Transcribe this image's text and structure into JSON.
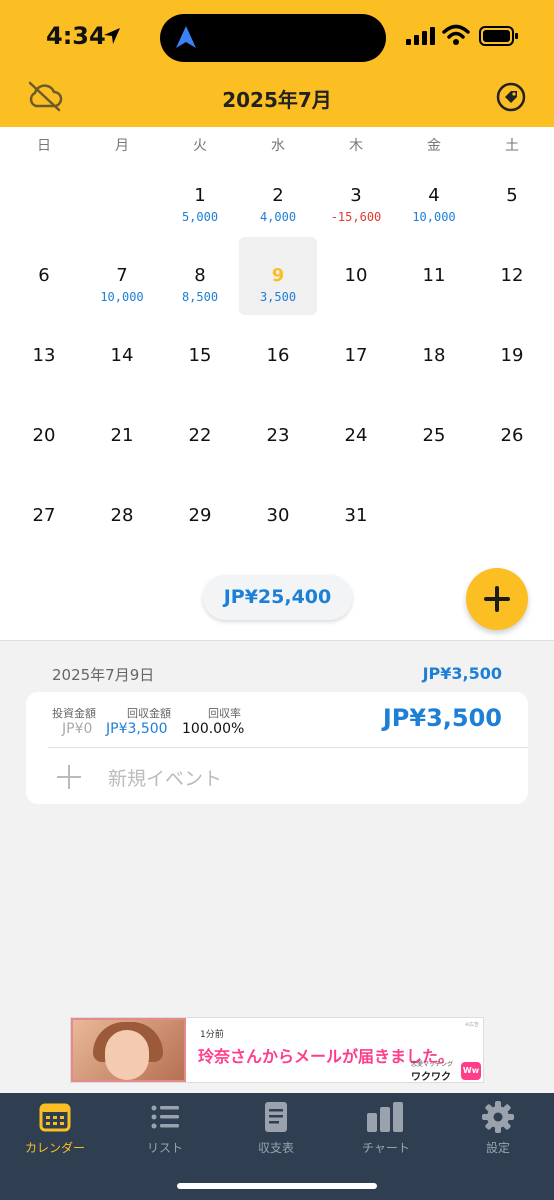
{
  "status_bar": {
    "time": "4:34"
  },
  "header": {
    "title": "2025年7月",
    "left_icon": "cloud-off-icon",
    "right_icon": "tag-icon"
  },
  "colors": {
    "accent": "#fbbf24",
    "positive": "#1d7fd6",
    "negative": "#e53935",
    "tabbar": "#2f3e50"
  },
  "calendar": {
    "weekdays": [
      "日",
      "月",
      "火",
      "水",
      "木",
      "金",
      "土"
    ],
    "selected_day": "9",
    "days": [
      {
        "day": "1",
        "amount": "5,000"
      },
      {
        "day": "2",
        "amount": "4,000"
      },
      {
        "day": "3",
        "amount": "-15,600"
      },
      {
        "day": "4",
        "amount": "10,000"
      },
      {
        "day": "5",
        "amount": ""
      },
      {
        "day": "6",
        "amount": ""
      },
      {
        "day": "7",
        "amount": "10,000"
      },
      {
        "day": "8",
        "amount": "8,500"
      },
      {
        "day": "9",
        "amount": "3,500"
      },
      {
        "day": "10",
        "amount": ""
      },
      {
        "day": "11",
        "amount": ""
      },
      {
        "day": "12",
        "amount": ""
      },
      {
        "day": "13",
        "amount": ""
      },
      {
        "day": "14",
        "amount": ""
      },
      {
        "day": "15",
        "amount": ""
      },
      {
        "day": "16",
        "amount": ""
      },
      {
        "day": "17",
        "amount": ""
      },
      {
        "day": "18",
        "amount": ""
      },
      {
        "day": "19",
        "amount": ""
      },
      {
        "day": "20",
        "amount": ""
      },
      {
        "day": "21",
        "amount": ""
      },
      {
        "day": "22",
        "amount": ""
      },
      {
        "day": "23",
        "amount": ""
      },
      {
        "day": "24",
        "amount": ""
      },
      {
        "day": "25",
        "amount": ""
      },
      {
        "day": "26",
        "amount": ""
      },
      {
        "day": "27",
        "amount": ""
      },
      {
        "day": "28",
        "amount": ""
      },
      {
        "day": "29",
        "amount": ""
      },
      {
        "day": "30",
        "amount": ""
      },
      {
        "day": "31",
        "amount": ""
      }
    ],
    "month_total": "JP¥25,400"
  },
  "detail": {
    "date": "2025年7月9日",
    "day_total": "JP¥3,500",
    "invest_label": "投資金額",
    "invest_value": "JP¥0",
    "return_label": "回収金額",
    "return_value": "JP¥3,500",
    "rate_label": "回収率",
    "rate_value": "100.00%",
    "amount": "JP¥3,500",
    "new_event_label": "新規イベント"
  },
  "ad": {
    "time": "1分前",
    "message": "玲奈さんからメールが届きました。",
    "sub": "恋愛マッチング",
    "brand": "ワクワク",
    "logo": "Ww",
    "corner": "※広告"
  },
  "tabs": [
    {
      "label": "カレンダー",
      "icon": "calendar-icon",
      "active": true
    },
    {
      "label": "リスト",
      "icon": "list-icon",
      "active": false
    },
    {
      "label": "収支表",
      "icon": "document-icon",
      "active": false
    },
    {
      "label": "チャート",
      "icon": "bar-chart-icon",
      "active": false
    },
    {
      "label": "設定",
      "icon": "gear-icon",
      "active": false
    }
  ]
}
